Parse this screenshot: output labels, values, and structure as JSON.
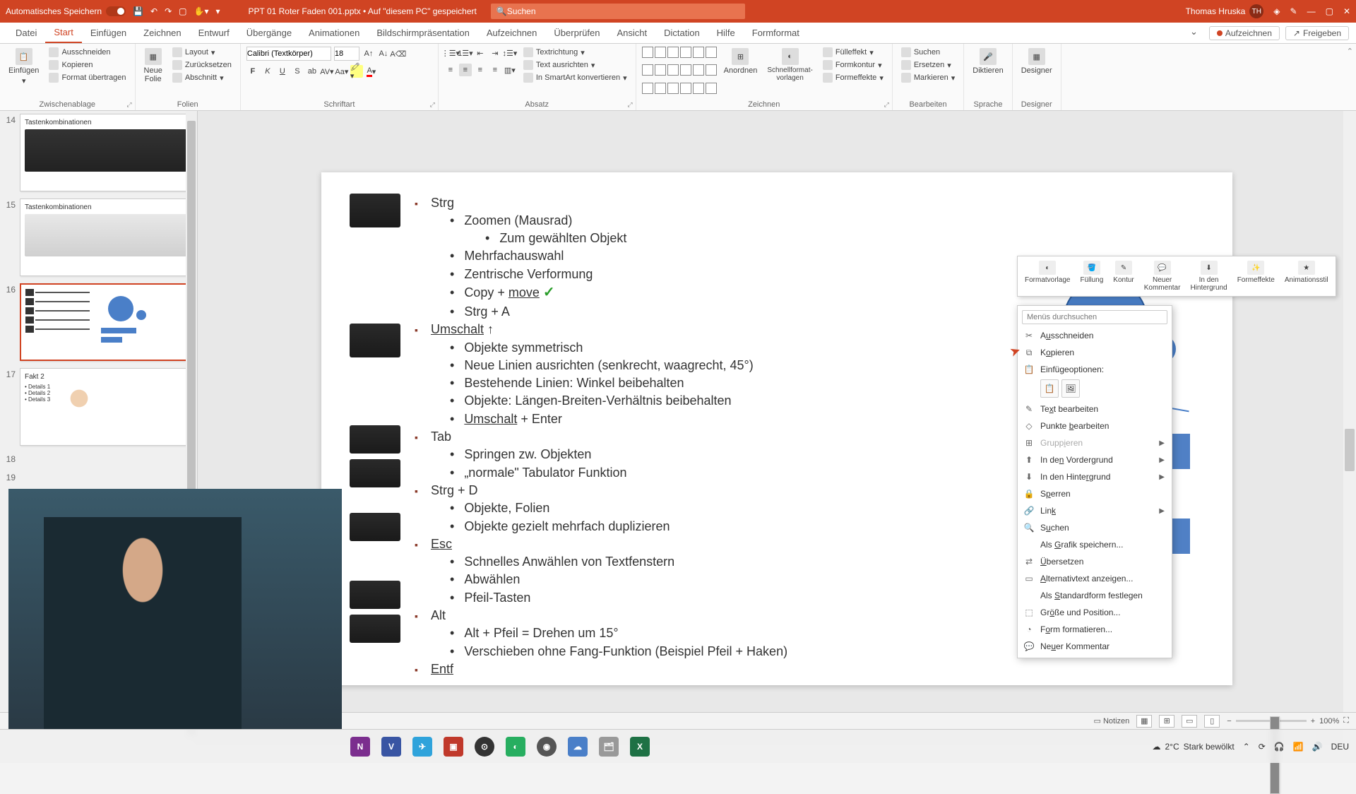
{
  "titlebar": {
    "autosave": "Automatisches Speichern",
    "doctitle": "PPT 01 Roter Faden 001.pptx • Auf \"diesem PC\" gespeichert",
    "search_placeholder": "Suchen",
    "user_name": "Thomas Hruska",
    "user_initials": "TH"
  },
  "tabs": {
    "items": [
      "Datei",
      "Start",
      "Einfügen",
      "Zeichnen",
      "Entwurf",
      "Übergänge",
      "Animationen",
      "Bildschirmpräsentation",
      "Aufzeichnen",
      "Überprüfen",
      "Ansicht",
      "Dictation",
      "Hilfe",
      "Formformat"
    ],
    "active": 1,
    "aufzeichnen": "Aufzeichnen",
    "freigeben": "Freigeben"
  },
  "ribbon": {
    "clipboard": {
      "label": "Zwischenablage",
      "paste": "Einfügen",
      "cut": "Ausschneiden",
      "copy": "Kopieren",
      "format": "Format übertragen"
    },
    "slides": {
      "label": "Folien",
      "new": "Neue\nFolie",
      "layout": "Layout",
      "reset": "Zurücksetzen",
      "section": "Abschnitt"
    },
    "font": {
      "label": "Schriftart",
      "name": "Calibri (Textkörper)",
      "size": "18"
    },
    "para": {
      "label": "Absatz",
      "textdir": "Textrichtung",
      "align": "Text ausrichten",
      "smartart": "In SmartArt konvertieren"
    },
    "drawing": {
      "label": "Zeichnen",
      "arrange": "Anordnen",
      "quick": "Schnellformat-\nvorlagen",
      "fill": "Fülleffekt",
      "outline": "Formkontur",
      "effects": "Formeffekte"
    },
    "editing": {
      "label": "Bearbeiten",
      "find": "Suchen",
      "replace": "Ersetzen",
      "select": "Markieren"
    },
    "voice": {
      "label": "Sprache",
      "dictate": "Diktieren"
    },
    "designer": {
      "label": "Designer",
      "btn": "Designer"
    }
  },
  "thumbs": [
    {
      "num": "14",
      "title": "Tastenkombinationen"
    },
    {
      "num": "15",
      "title": "Tastenkombinationen"
    },
    {
      "num": "16",
      "title": "",
      "selected": true
    },
    {
      "num": "17",
      "title": "Fakt 2"
    },
    {
      "num": "18",
      "title": ""
    },
    {
      "num": "19",
      "title": ""
    }
  ],
  "slide": {
    "bullets": [
      {
        "l": 1,
        "t": "Strg"
      },
      {
        "l": 2,
        "t": "Zoomen (Mausrad)"
      },
      {
        "l": 3,
        "t": "Zum gewählten Objekt"
      },
      {
        "l": 2,
        "t": "Mehrfachauswahl"
      },
      {
        "l": 2,
        "t": "Zentrische Verformung"
      },
      {
        "l": 2,
        "t": "Copy + ",
        "u": "move",
        "check": true
      },
      {
        "l": 2,
        "t": "Strg + A"
      },
      {
        "l": 1,
        "u": "Umschalt",
        "after": " ↑"
      },
      {
        "l": 2,
        "t": "Objekte symmetrisch"
      },
      {
        "l": 2,
        "t": "Neue Linien ausrichten (senkrecht, waagrecht, 45°)"
      },
      {
        "l": 2,
        "t": "Bestehende Linien: Winkel beibehalten"
      },
      {
        "l": 2,
        "t": "Objekte: Längen-Breiten-Verhältnis beibehalten"
      },
      {
        "l": 2,
        "u": "Umschalt",
        "after": " + Enter"
      },
      {
        "l": 1,
        "t": "Tab"
      },
      {
        "l": 2,
        "t": "Springen zw. Objekten"
      },
      {
        "l": 2,
        "t": "„normale\" Tabulator Funktion"
      },
      {
        "l": 1,
        "t": "Strg + D"
      },
      {
        "l": 2,
        "t": "Objekte, Folien"
      },
      {
        "l": 2,
        "t": "Objekte gezielt mehrfach duplizieren"
      },
      {
        "l": 1,
        "u": "Esc"
      },
      {
        "l": 2,
        "t": "Schnelles Anwählen von Textfenstern"
      },
      {
        "l": 2,
        "t": "Abwählen"
      },
      {
        "l": 2,
        "t": "Pfeil-Tasten"
      },
      {
        "l": 1,
        "t": "Alt"
      },
      {
        "l": 2,
        "t": "Alt + Pfeil = Drehen um 15°"
      },
      {
        "l": 2,
        "t": "Verschieben ohne Fang-Funktion (Beispiel Pfeil + Haken)"
      },
      {
        "l": 1,
        "u": "Entf"
      }
    ]
  },
  "minitoolbar": [
    "Formatvorlage",
    "Füllung",
    "Kontur",
    "Neuer\nKommentar",
    "In den\nHintergrund",
    "Formeffekte",
    "Animationsstil"
  ],
  "contextmenu": {
    "search_placeholder": "Menüs durchsuchen",
    "items": [
      {
        "icon": "✂",
        "label": "A",
        "u": "u",
        "rest": "sschneiden"
      },
      {
        "icon": "⧉",
        "label": "K",
        "u": "o",
        "rest": "pieren"
      },
      {
        "icon": "📋",
        "label": "Einfü",
        "u": "g",
        "rest": "eoptionen:",
        "header": true
      },
      {
        "paste": true
      },
      {
        "icon": "✎",
        "label": "Te",
        "u": "x",
        "rest": "t bearbeiten"
      },
      {
        "icon": "◇",
        "label": "Punkte ",
        "u": "b",
        "rest": "earbeiten"
      },
      {
        "icon": "⊞",
        "label": "Grupp",
        "u": "i",
        "rest": "eren",
        "disabled": true,
        "sub": true
      },
      {
        "icon": "⬆",
        "label": "In de",
        "u": "n",
        "rest": " Vordergrund",
        "sub": true
      },
      {
        "icon": "⬇",
        "label": "In den Hinte",
        "u": "r",
        "rest": "grund",
        "sub": true
      },
      {
        "icon": "🔒",
        "label": "S",
        "u": "p",
        "rest": "erren"
      },
      {
        "icon": "🔗",
        "label": "Lin",
        "u": "k",
        "rest": "",
        "sub": true
      },
      {
        "icon": "🔍",
        "label": "S",
        "u": "u",
        "rest": "chen"
      },
      {
        "label": "Als ",
        "u": "G",
        "rest": "rafik speichern..."
      },
      {
        "icon": "⇄",
        "label": "",
        "u": "Ü",
        "rest": "bersetzen"
      },
      {
        "icon": "▭",
        "label": "",
        "u": "A",
        "rest": "lternativtext anzeigen..."
      },
      {
        "label": "Als ",
        "u": "S",
        "rest": "tandardform festlegen"
      },
      {
        "icon": "⬚",
        "label": "Gr",
        "u": "ö",
        "rest": "ße und Position..."
      },
      {
        "icon": "◔",
        "label": "F",
        "u": "o",
        "rest": "rm formatieren..."
      },
      {
        "icon": "💬",
        "label": "Ne",
        "u": "u",
        "rest": "er Kommentar"
      }
    ]
  },
  "statusbar": {
    "notes": "Notizen",
    "zoom": "100%"
  },
  "taskbar": {
    "weather_temp": "2°C",
    "weather_text": "Stark bewölkt",
    "lang": "DEU"
  }
}
